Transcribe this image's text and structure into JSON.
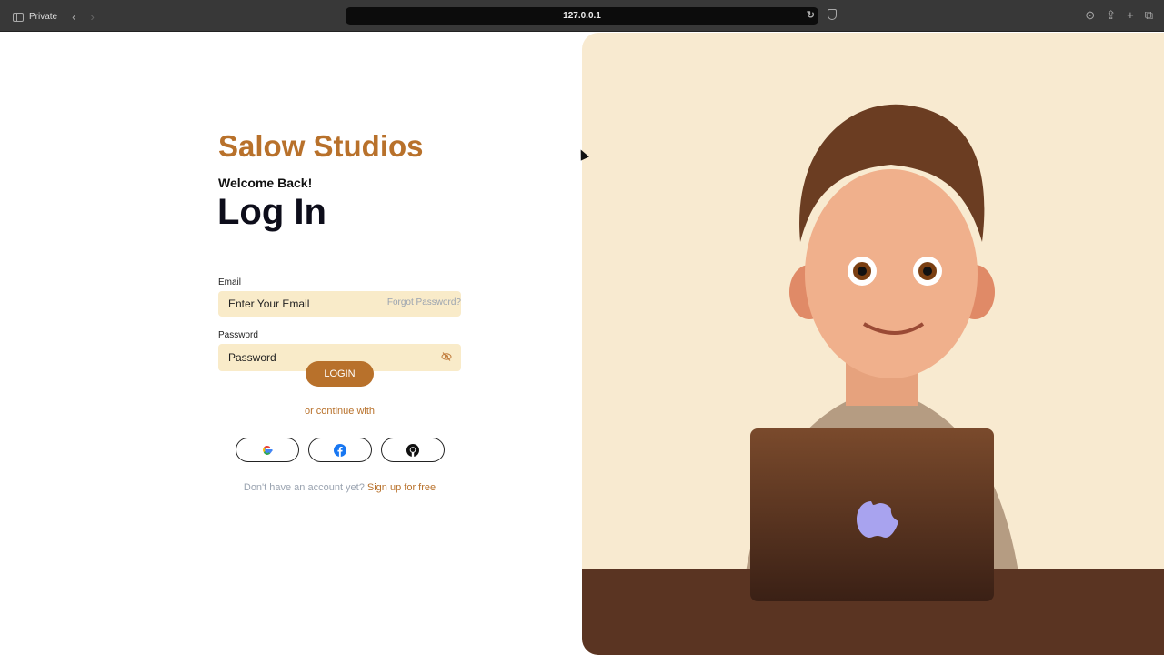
{
  "browser": {
    "private_label": "Private",
    "url": "127.0.0.1"
  },
  "login": {
    "brand": "Salow Studios",
    "welcome": "Welcome Back!",
    "title": "Log In",
    "email_label": "Email",
    "email_placeholder": "Enter Your Email",
    "password_label": "Password",
    "forgot": "Forgot Password?",
    "password_placeholder": "Password",
    "login_button": "LOGIN",
    "or_continue": "or continue with",
    "no_account": "Don't have an account yet?",
    "signup": "Sign up for free"
  },
  "colors": {
    "accent": "#b8712b",
    "field_bg": "#f9ebc9",
    "illustration_bg": "#f8ead0"
  }
}
